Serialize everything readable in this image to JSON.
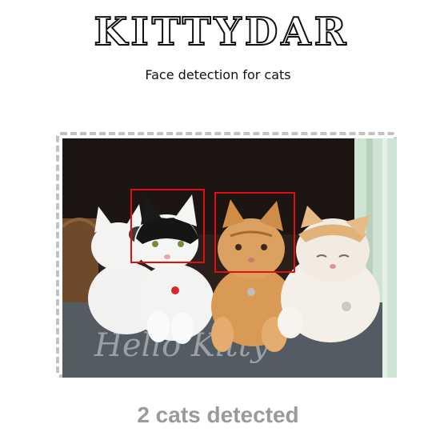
{
  "app": {
    "logo_text": "KITTYDAR",
    "tagline": "Face detection for cats"
  },
  "image": {
    "icon": "cat-photo",
    "blanket_text": "Hello Kitty",
    "detections": [
      {
        "label": "cat-face-1"
      },
      {
        "label": "cat-face-2"
      }
    ]
  },
  "result": {
    "status": "2 cats detected"
  },
  "colors": {
    "detection_box": "#e01010",
    "status_text": "#9a9a9a",
    "drop_border": "#c2c2c2"
  }
}
